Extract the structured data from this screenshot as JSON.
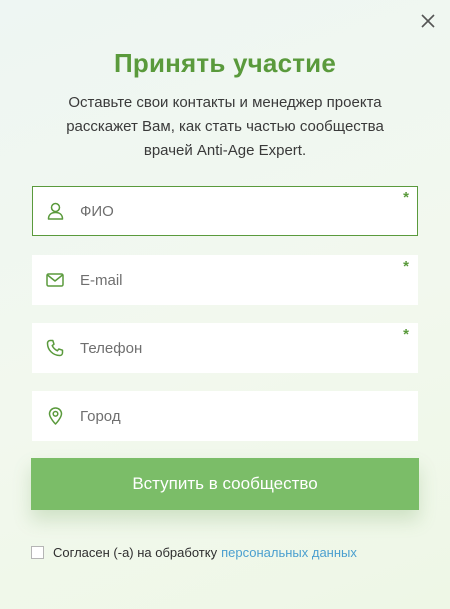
{
  "modal": {
    "title": "Принять участие",
    "description": "Оставьте свои контакты и менеджер проекта расскажет Вам, как стать частью сообщества врачей Anti-Age Expert."
  },
  "form": {
    "fields": [
      {
        "placeholder": "ФИО",
        "value": "",
        "required": true,
        "icon": "user-icon"
      },
      {
        "placeholder": "E-mail",
        "value": "",
        "required": true,
        "icon": "mail-icon"
      },
      {
        "placeholder": "Телефон",
        "value": "",
        "required": true,
        "icon": "phone-icon"
      },
      {
        "placeholder": "Город",
        "value": "",
        "required": false,
        "icon": "location-pin-icon"
      }
    ],
    "required_mark": "*",
    "submit_label": "Вступить в сообщество",
    "consent_text": "Согласен (-а) на обработку",
    "consent_link": "персональных данных",
    "consent_checked": false
  },
  "colors": {
    "accent": "#5a9a3c",
    "button": "#7bbd68",
    "link": "#4a9fcf"
  }
}
